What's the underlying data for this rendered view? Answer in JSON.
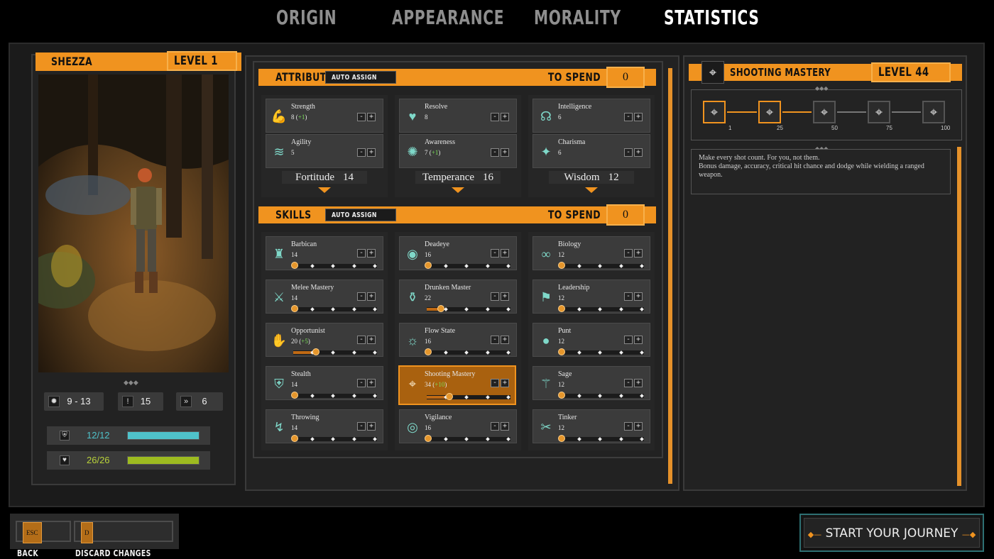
{
  "tabs": [
    {
      "label": "ORIGIN"
    },
    {
      "label": "APPEARANCE"
    },
    {
      "label": "MORALITY"
    },
    {
      "label": "STATISTICS"
    }
  ],
  "character": {
    "name": "SHEZZA",
    "level": "LEVEL 1",
    "stats": [
      {
        "icon": "damage-icon",
        "value": "9 - 13"
      },
      {
        "icon": "exclamation-icon",
        "value": "15"
      },
      {
        "icon": "speed-icon",
        "value": "6"
      }
    ],
    "armor": {
      "label": "12/12",
      "fraction": 1.0,
      "color": "#4fc2ca"
    },
    "health": {
      "label": "26/26",
      "fraction": 1.0,
      "color": "#9dbb20"
    }
  },
  "attributes": {
    "title": "ATTRIBUTES",
    "auto_assign": "AUTO ASSIGN",
    "to_spend_label": "TO SPEND",
    "to_spend": "0",
    "groups": [
      {
        "aggregate_label": "Fortitude",
        "aggregate_value": "14",
        "items": [
          {
            "name": "Strength",
            "value": "8",
            "bonus": "+1",
            "icon": "strength-icon"
          },
          {
            "name": "Agility",
            "value": "5",
            "bonus": "",
            "icon": "agility-icon"
          }
        ]
      },
      {
        "aggregate_label": "Temperance",
        "aggregate_value": "16",
        "items": [
          {
            "name": "Resolve",
            "value": "8",
            "bonus": "",
            "icon": "resolve-icon"
          },
          {
            "name": "Awareness",
            "value": "7",
            "bonus": "+1",
            "icon": "awareness-icon"
          }
        ]
      },
      {
        "aggregate_label": "Wisdom",
        "aggregate_value": "12",
        "items": [
          {
            "name": "Intelligence",
            "value": "6",
            "bonus": "",
            "icon": "intelligence-icon"
          },
          {
            "name": "Charisma",
            "value": "6",
            "bonus": "",
            "icon": "charisma-icon"
          }
        ]
      }
    ]
  },
  "skills": {
    "title": "SKILLS",
    "auto_assign": "AUTO ASSIGN",
    "to_spend_label": "TO SPEND",
    "to_spend": "0",
    "columns": [
      [
        {
          "name": "Barbican",
          "value": "14",
          "bonus": "",
          "progress": 0.0
        },
        {
          "name": "Melee Mastery",
          "value": "14",
          "bonus": "",
          "progress": 0.0
        },
        {
          "name": "Opportunist",
          "value": "20",
          "bonus": "+5",
          "progress": 0.25
        },
        {
          "name": "Stealth",
          "value": "14",
          "bonus": "",
          "progress": 0.0
        },
        {
          "name": "Throwing",
          "value": "14",
          "bonus": "",
          "progress": 0.0
        }
      ],
      [
        {
          "name": "Deadeye",
          "value": "16",
          "bonus": "",
          "progress": 0.0
        },
        {
          "name": "Drunken Master",
          "value": "22",
          "bonus": "",
          "progress": 0.15
        },
        {
          "name": "Flow State",
          "value": "16",
          "bonus": "",
          "progress": 0.0
        },
        {
          "name": "Shooting Mastery",
          "value": "34",
          "bonus": "+10",
          "progress": 0.25,
          "selected": true
        },
        {
          "name": "Vigilance",
          "value": "16",
          "bonus": "",
          "progress": 0.0
        }
      ],
      [
        {
          "name": "Biology",
          "value": "12",
          "bonus": "",
          "progress": 0.0
        },
        {
          "name": "Leadership",
          "value": "12",
          "bonus": "",
          "progress": 0.0
        },
        {
          "name": "Punt",
          "value": "12",
          "bonus": "",
          "progress": 0.0
        },
        {
          "name": "Sage",
          "value": "12",
          "bonus": "",
          "progress": 0.0
        },
        {
          "name": "Tinker",
          "value": "12",
          "bonus": "",
          "progress": 0.0
        }
      ]
    ]
  },
  "plus": "+",
  "minus": "-",
  "mastery": {
    "title": "SHOOTING MASTERY",
    "level": "LEVEL 44",
    "milestones": [
      "1",
      "25",
      "50",
      "75",
      "100"
    ],
    "description": [
      "Make every shot count. For you, not them.",
      "Bonus damage, accuracy, critical hit chance and dodge while wielding a ranged weapon."
    ]
  },
  "footer": {
    "back_key": "ESC",
    "back": "BACK",
    "discard_key": "D",
    "discard": "DISCARD CHANGES",
    "start": "START YOUR JOURNEY"
  },
  "colors": {
    "accent": "#f0931f",
    "teal": "#7fd8c9"
  }
}
